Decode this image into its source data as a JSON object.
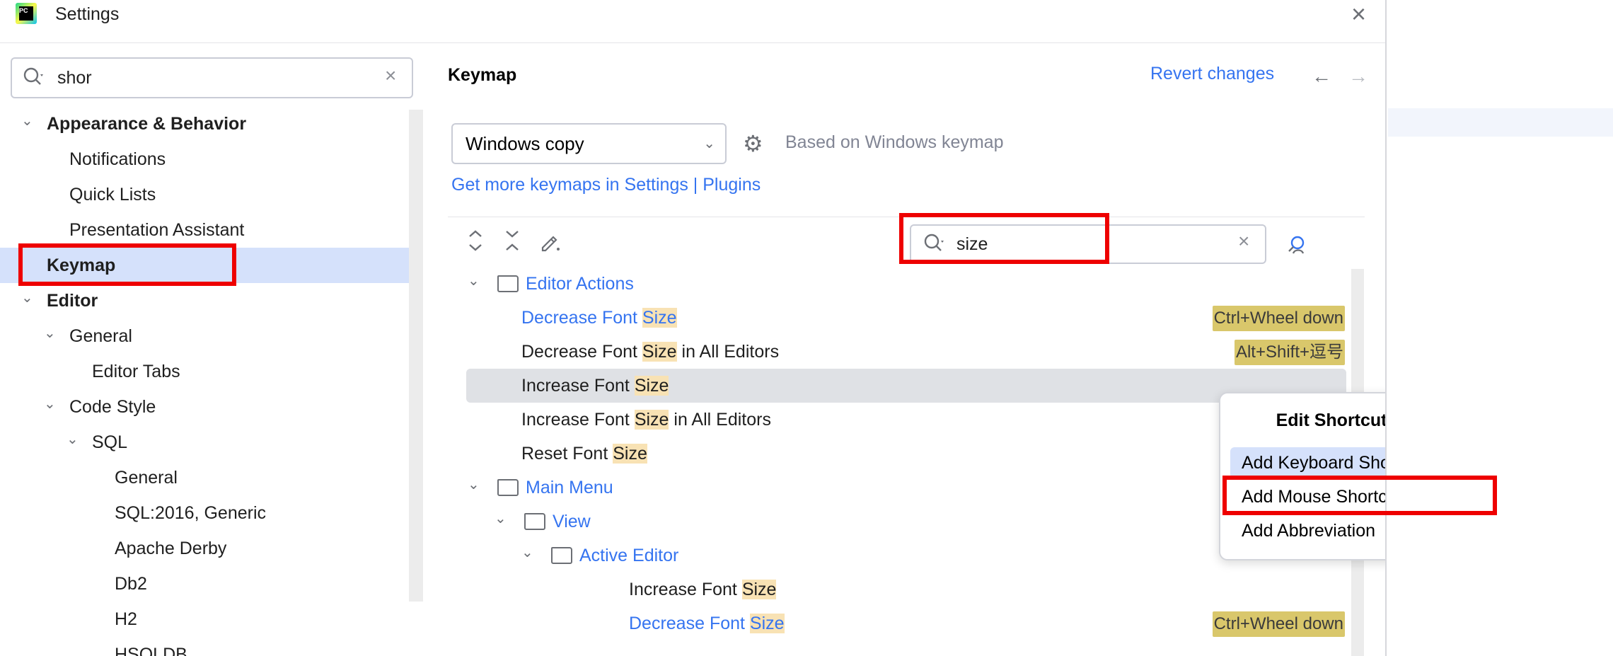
{
  "window": {
    "title": "Settings",
    "app_logo": "PC",
    "close_icon": "×"
  },
  "left": {
    "search": {
      "value": "shor",
      "clear_icon": "×"
    },
    "tree": [
      {
        "label": "Appearance & Behavior",
        "level": 0,
        "expanded": true,
        "bold": true
      },
      {
        "label": "Notifications",
        "level": 1
      },
      {
        "label": "Quick Lists",
        "level": 1
      },
      {
        "label": "Presentation Assistant",
        "level": 1
      },
      {
        "label": "Keymap",
        "level": 0,
        "selected": true,
        "bold": true
      },
      {
        "label": "Editor",
        "level": 0,
        "expanded": true,
        "bold": true
      },
      {
        "label": "General",
        "level": 1,
        "expanded": true
      },
      {
        "label": "Editor Tabs",
        "level": 2
      },
      {
        "label": "Code Style",
        "level": 1,
        "expanded": true
      },
      {
        "label": "SQL",
        "level": 2,
        "expanded": true
      },
      {
        "label": "General",
        "level": 3
      },
      {
        "label": "SQL:2016, Generic",
        "level": 3
      },
      {
        "label": "Apache Derby",
        "level": 3
      },
      {
        "label": "Db2",
        "level": 3
      },
      {
        "label": "H2",
        "level": 3
      },
      {
        "label": "HSQLDB",
        "level": 3
      }
    ]
  },
  "right": {
    "title": "Keymap",
    "revert_label": "Revert changes",
    "nav_back_icon": "←",
    "nav_forward_icon": "→",
    "keymap_select": {
      "value": "Windows copy"
    },
    "gear_icon": "⚙",
    "based_on": "Based on Windows keymap",
    "more_keymaps_link": "Get more keymaps in Settings | Plugins",
    "toolbar": {
      "expand_all_icon": "⌃⌄",
      "collapse_all_icon": "⌄⌃",
      "edit_icon": "✎"
    },
    "action_search": {
      "value": "size",
      "clear_icon": "×"
    },
    "find_by_shortcut_icon": "⚲"
  },
  "actions": [
    {
      "type": "folder",
      "label": "Editor Actions",
      "indent": 0
    },
    {
      "type": "action",
      "pre": "Decrease Font ",
      "match": "Size",
      "post": "",
      "indent": 1,
      "link": true,
      "shortcut": "Ctrl+Wheel down"
    },
    {
      "type": "action",
      "pre": "Decrease Font ",
      "match": "Size",
      "post": " in All Editors",
      "indent": 1,
      "shortcut": "Alt+Shift+逗号"
    },
    {
      "type": "action",
      "pre": "Increase Font ",
      "match": "Size",
      "post": "",
      "indent": 1,
      "selected": true
    },
    {
      "type": "action",
      "pre": "Increase Font ",
      "match": "Size",
      "post": " in All Editors",
      "indent": 1
    },
    {
      "type": "action",
      "pre": "Reset Font ",
      "match": "Size",
      "post": "",
      "indent": 1
    },
    {
      "type": "folder",
      "label": "Main Menu",
      "indent": 0
    },
    {
      "type": "folder",
      "label": "View",
      "indent": 1
    },
    {
      "type": "folder",
      "label": "Active Editor",
      "indent": 2
    },
    {
      "type": "action",
      "pre": "Increase Font ",
      "match": "Size",
      "post": "",
      "indent": 3
    },
    {
      "type": "action",
      "pre": "Decrease Font ",
      "match": "Size",
      "post": "",
      "indent": 3,
      "link": true,
      "shortcut": "Ctrl+Wheel down"
    },
    {
      "type": "action",
      "pre": "",
      "match": "",
      "post": "",
      "indent": 3,
      "shortcut": ""
    }
  ],
  "popup": {
    "title": "Edit Shortcuts",
    "items": [
      "Add Keyboard Shortcut",
      "Add Mouse Shortcut",
      "Add Abbreviation"
    ]
  },
  "colors": {
    "accent": "#3574f0",
    "selection": "#d5e1fb",
    "match_highlight": "#f8e2b4",
    "shortcut_bg": "#d9c76b",
    "annotation": "#ee0000"
  }
}
